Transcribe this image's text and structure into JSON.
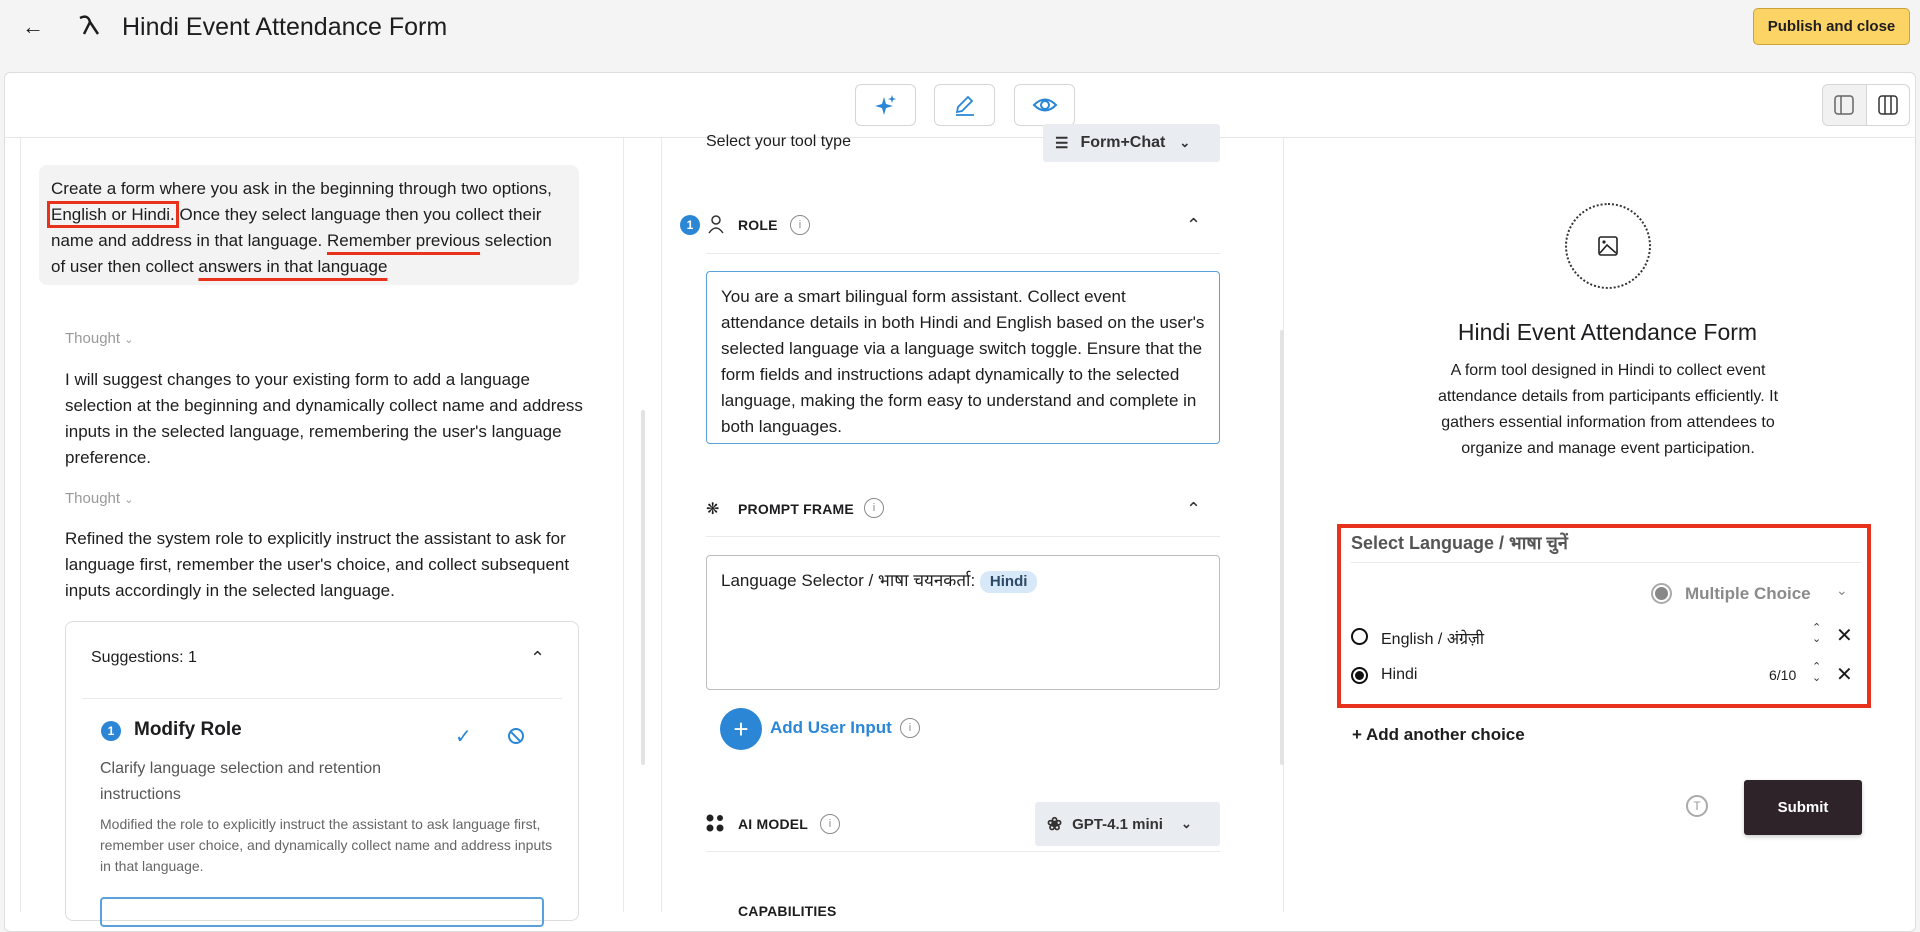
{
  "header": {
    "title": "Hindi Event Attendance Form",
    "publish_label": "Publish and close"
  },
  "toolbar": {
    "buttons": [
      "sparkle-icon",
      "pencil-icon",
      "eye-icon"
    ],
    "view_toggle": [
      "single-panel-icon",
      "split-panel-icon"
    ]
  },
  "chat": {
    "user_message": {
      "part1": "Create a form where you ask in the beginning through two options, ",
      "highlight1": "English or Hindi.",
      "part2": " Once they select language then you collect their name and address in that language. ",
      "highlight2": "Remember previous",
      "part3": " selection of user then collect ",
      "highlight3": "answers in that language"
    },
    "thought_label": "Thought",
    "thought1": "I will suggest changes to your existing form to add a language selection at the beginning and dynamically collect name and address inputs in the selected language, remembering the user's language preference.",
    "thought2": "Refined the system role to explicitly instruct the assistant to ask for language first, remember the user's choice, and collect subsequent inputs accordingly in the selected language.",
    "suggestions": {
      "header": "Suggestions: 1",
      "items": [
        {
          "number": "1",
          "title": "Modify Role",
          "subtitle": "Clarify language selection and retention instructions",
          "description": "Modified the role to explicitly instruct the assistant to ask language first, remember user choice, and dynamically collect name and address inputs in that language."
        }
      ]
    }
  },
  "config": {
    "tool_type_label": "Select your tool type",
    "tool_type_value": "Form+Chat",
    "role": {
      "badge": "1",
      "label": "ROLE",
      "text": "You are a smart bilingual form assistant. Collect event attendance details in both Hindi and English based on the user's selected language via a language switch toggle. Ensure that the form fields and instructions adapt dynamically to the selected language, making the form easy to understand and complete in both languages."
    },
    "prompt_frame": {
      "label": "PROMPT FRAME",
      "text": "Language Selector / भाषा चयनकर्ता:",
      "chip": "Hindi"
    },
    "add_user_input": "Add User Input",
    "ai_model": {
      "label": "AI MODEL",
      "value": "GPT-4.1 mini"
    },
    "capabilities": {
      "label": "CAPABILITIES"
    }
  },
  "preview": {
    "title": "Hindi Event Attendance Form",
    "description": "A form tool designed in Hindi to collect event attendance details from participants efficiently. It gathers essential information from attendees to organize and manage event participation.",
    "question": "Select Language / भाषा चुनें",
    "question_type": "Multiple Choice",
    "options": [
      {
        "label": "English / अंग्रेज़ी",
        "selected": false
      },
      {
        "label": "Hindi",
        "selected": true,
        "counter": "6/10"
      }
    ],
    "add_choice": "+ Add another choice",
    "submit": "Submit"
  },
  "colors": {
    "accent": "#2b86d6",
    "publish": "#fcd466",
    "submit": "#2d2329",
    "annotation": "#e8321c"
  }
}
